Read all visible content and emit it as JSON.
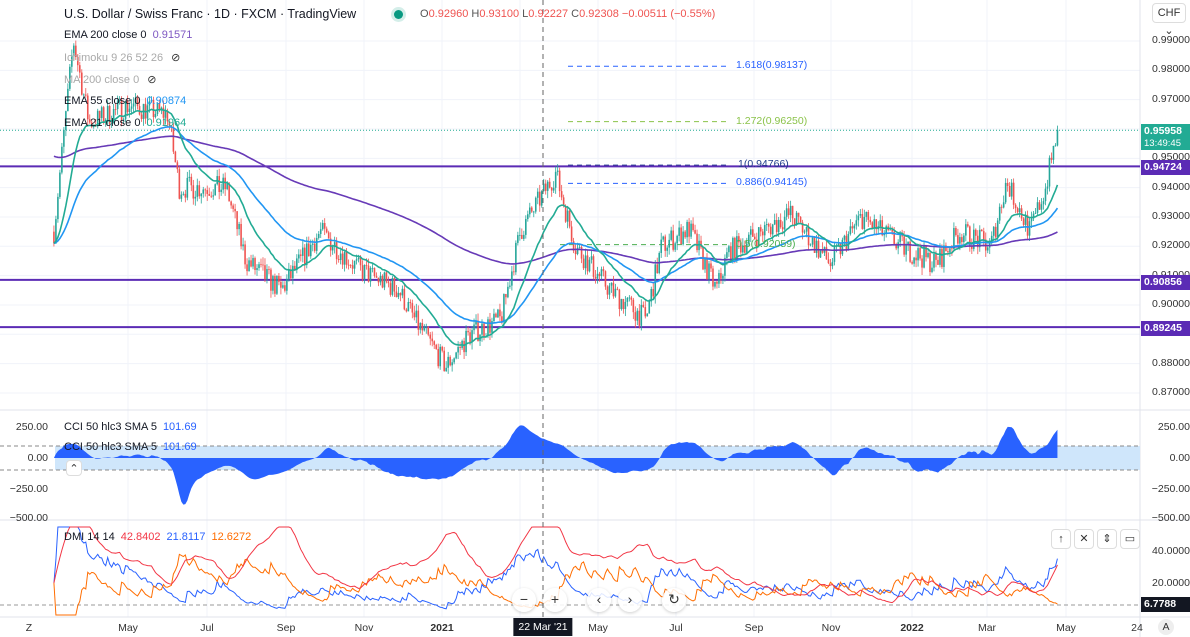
{
  "header": {
    "title": "U.S. Dollar / Swiss Franc · 1D · FXCM · TradingView",
    "ohlc": {
      "o_label": "O",
      "o": "0.92960",
      "h_label": "H",
      "h": "0.93100",
      "l_label": "L",
      "l": "0.92227",
      "c_label": "C",
      "c": "0.92308",
      "change": "−0.00511 (−0.55%)"
    }
  },
  "indicators": [
    {
      "label": "EMA 200 close 0",
      "value": "0.91571",
      "color": "#7e57c2"
    },
    {
      "label": "Ichimoku 9 26 52 26",
      "value": "",
      "hidden": true
    },
    {
      "label": "MA 200 close 0",
      "value": "",
      "hidden": true
    },
    {
      "label": "EMA 55 close 0",
      "value": "0.90874",
      "color": "#2196f3"
    },
    {
      "label": "EMA 21 close 0",
      "value": "0.91964",
      "color": "#22ab94"
    }
  ],
  "currency_button": "CHF",
  "price_axis": [
    "0.99000",
    "0.98000",
    "0.97000",
    "0.95000",
    "0.94000",
    "0.93000",
    "0.92000",
    "0.91000",
    "0.90000",
    "0.89000",
    "0.88000",
    "0.87000"
  ],
  "price_tags": {
    "last": "0.95958",
    "countdown": "13:49:45",
    "levels": [
      "0.94724",
      "0.90856",
      "0.89245"
    ]
  },
  "fib_levels": [
    {
      "label": "1.618(0.98137)",
      "price": 0.98137,
      "color": "#2962ff"
    },
    {
      "label": "1.272(0.96250)",
      "price": 0.9625,
      "color": "#8bc34a"
    },
    {
      "label": "1(0.94766)",
      "price": 0.94766,
      "color": "#1e3a8a"
    },
    {
      "label": "0.886(0.94145)",
      "price": 0.94145,
      "color": "#2962ff"
    },
    {
      "label": "0.5(0.92059)",
      "price": 0.92059,
      "color": "#4caf50"
    }
  ],
  "cci": {
    "legend1": "CCI 50 hlc3 SMA 5",
    "legend2": "CCI 50 hlc3 SMA 5",
    "value": "101.69",
    "axis": [
      "250.00",
      "0.00",
      "−250.00",
      "−500.00"
    ]
  },
  "dmi": {
    "legend": "DMI 14 14",
    "adx": "42.8402",
    "plus": "21.8117",
    "minus": "12.6272",
    "axis": [
      "40.0000",
      "20.0000"
    ],
    "tag": "6.7788"
  },
  "time_axis": [
    "May",
    "Jul",
    "Sep",
    "Nov",
    "2021",
    "May",
    "Jul",
    "Sep",
    "Nov",
    "2022",
    "Mar",
    "May",
    "24"
  ],
  "crosshair_label": "22 Mar '21",
  "footer": {
    "z": "Z",
    "a": "A"
  },
  "chart_data": {
    "type": "candlestick",
    "title": "U.S. Dollar / Swiss Franc · 1D · FXCM",
    "x_unit": "months since Mar 2020",
    "ylim": [
      0.865,
      0.995
    ],
    "anchors": [
      [
        0.1,
        0.925
      ],
      [
        0.6,
        0.99
      ],
      [
        1.0,
        0.962
      ],
      [
        2.0,
        0.968
      ],
      [
        3.0,
        0.965
      ],
      [
        3.3,
        0.94
      ],
      [
        4.5,
        0.94
      ],
      [
        5.0,
        0.915
      ],
      [
        5.9,
        0.905
      ],
      [
        6.9,
        0.925
      ],
      [
        7.9,
        0.912
      ],
      [
        8.9,
        0.905
      ],
      [
        9.3,
        0.895
      ],
      [
        10.1,
        0.879
      ],
      [
        10.7,
        0.89
      ],
      [
        11.5,
        0.895
      ],
      [
        12.0,
        0.925
      ],
      [
        12.9,
        0.945
      ],
      [
        13.4,
        0.92
      ],
      [
        14.3,
        0.905
      ],
      [
        15.2,
        0.895
      ],
      [
        15.6,
        0.92
      ],
      [
        16.3,
        0.926
      ],
      [
        17.0,
        0.905
      ],
      [
        17.3,
        0.918
      ],
      [
        18.9,
        0.931
      ],
      [
        19.9,
        0.914
      ],
      [
        20.7,
        0.93
      ],
      [
        21.7,
        0.92
      ],
      [
        22.6,
        0.914
      ],
      [
        23.2,
        0.925
      ],
      [
        24.0,
        0.92
      ],
      [
        24.4,
        0.942
      ],
      [
        25.0,
        0.925
      ],
      [
        25.4,
        0.94
      ],
      [
        25.7,
        0.9596
      ]
    ],
    "horizontal_levels": [
      0.94724,
      0.90856,
      0.89245
    ],
    "series": [
      "EMA 200",
      "EMA 55",
      "EMA 21"
    ]
  }
}
